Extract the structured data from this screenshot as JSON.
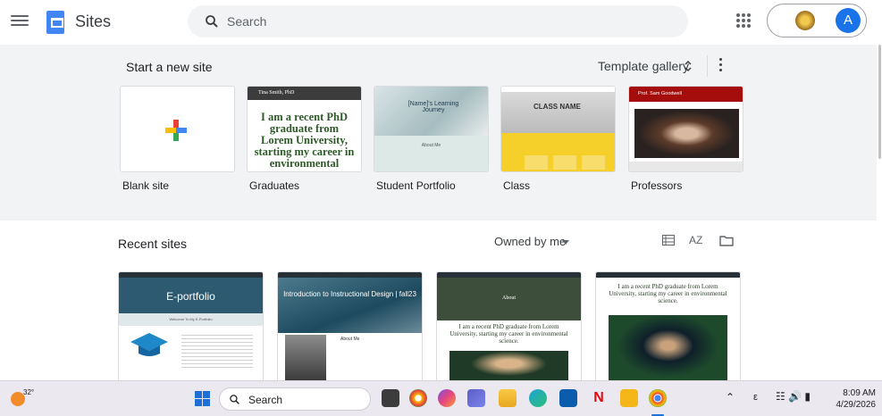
{
  "header": {
    "app_title": "Sites",
    "search_placeholder": "Search",
    "account_initial": "A"
  },
  "templates": {
    "section_title": "Start a new site",
    "gallery_label": "Template gallery",
    "items": [
      {
        "label": "Blank site"
      },
      {
        "label": "Graduates",
        "preview_header": "Tina Smith, PhD",
        "preview_text": "I am a recent PhD graduate from Lorem University, starting my career in environmental"
      },
      {
        "label": "Student Portfolio",
        "preview_title": "[Name]'s Learning Journey",
        "preview_about": "About Me"
      },
      {
        "label": "Class",
        "preview_title": "CLASS NAME"
      },
      {
        "label": "Professors",
        "preview_header": "Prof. Sam Goodwell"
      }
    ]
  },
  "recent": {
    "title": "Recent sites",
    "owner_filter": "Owned by me",
    "sort_label": "AZ",
    "sites": [
      {
        "banner": "E-portfolio",
        "welcome": "Welcome To My E-Portfolio"
      },
      {
        "banner": "Introduction to Instructional Design | fall23",
        "about": "About Me"
      },
      {
        "banner": "About",
        "text": "I am a recent PhD graduate from Lorem University, starting my career in environmental science."
      },
      {
        "text": "I am a recent PhD graduate from Lorem University, starting my career in environmental science."
      }
    ]
  },
  "taskbar": {
    "temperature": "32°",
    "search_label": "Search",
    "language": "ε",
    "time": "8:09 AM",
    "date": "4/29/2026"
  },
  "colors": {
    "accent": "#1a73e8",
    "sites_blue": "#4285f4",
    "template_bg": "#f1f3f4"
  }
}
